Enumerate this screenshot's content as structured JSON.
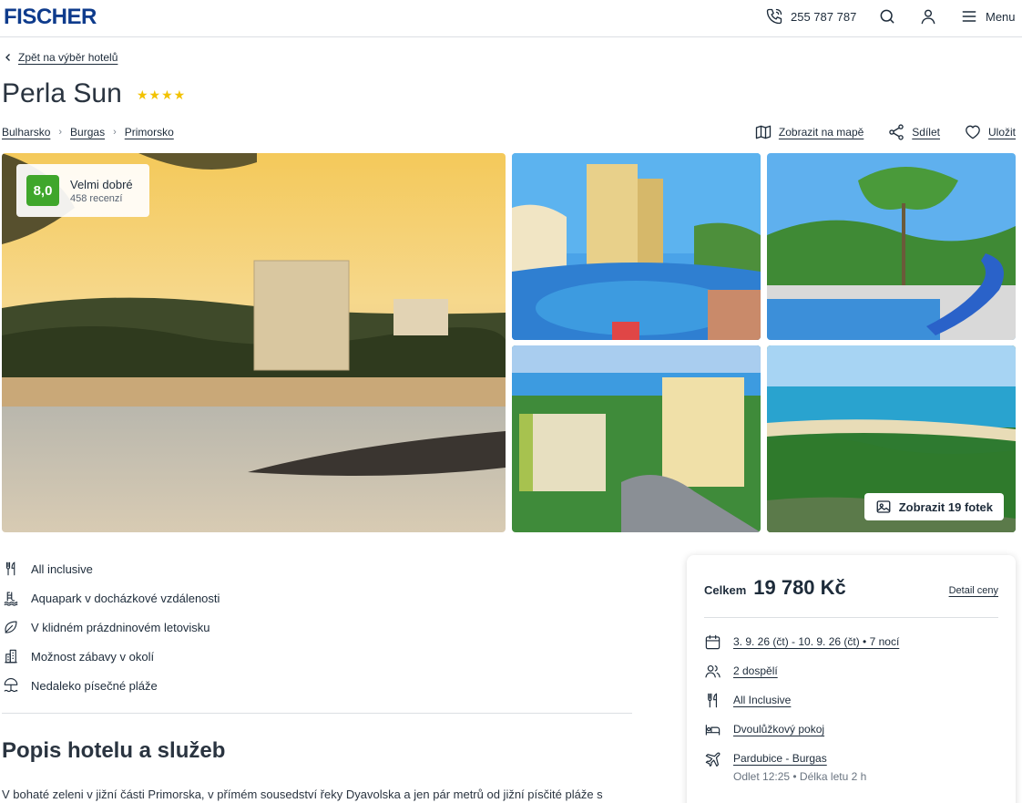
{
  "header": {
    "logo": "FISCHER",
    "phone": "255 787 787",
    "menu_label": "Menu"
  },
  "back_link": "Zpět na výběr hotelů",
  "hotel": {
    "name": "Perla Sun",
    "stars": "★★★★"
  },
  "breadcrumbs": [
    "Bulharsko",
    "Burgas",
    "Primorsko"
  ],
  "actions": {
    "map": "Zobrazit na mapě",
    "share": "Sdílet",
    "save": "Uložit"
  },
  "rating": {
    "score": "8,0",
    "label": "Velmi dobré",
    "reviews": "458 recenzí"
  },
  "show_photos": "Zobrazit 19 fotek",
  "features": [
    {
      "icon": "cutlery-icon",
      "label": "All inclusive"
    },
    {
      "icon": "aquapark-icon",
      "label": "Aquapark v docházkové vzdálenosti"
    },
    {
      "icon": "leaf-icon",
      "label": "V klidném prázdninovém letovisku"
    },
    {
      "icon": "city-icon",
      "label": "Možnost zábavy v okolí"
    },
    {
      "icon": "beach-umbrella-icon",
      "label": "Nedaleko písečné pláže"
    }
  ],
  "section_title": "Popis hotelu a služeb",
  "description": "V bohaté zeleni v jižní části Primorska, v přímém sousedství řeky Dyavolska a  jen pár metrů od jižní písčité pláže s",
  "price_card": {
    "total_label": "Celkem",
    "total_value": "19 780 Kč",
    "detail_link": "Detail ceny",
    "dates": "3. 9. 26 (čt) - 10. 9. 26 (čt) • 7 nocí",
    "persons": "2 dospělí",
    "board": "All Inclusive",
    "room": "Dvoulůžkový pokoj",
    "flight": "Pardubice - Burgas",
    "flight_info": "Odlet 12:25 • Délka letu 2 h"
  }
}
